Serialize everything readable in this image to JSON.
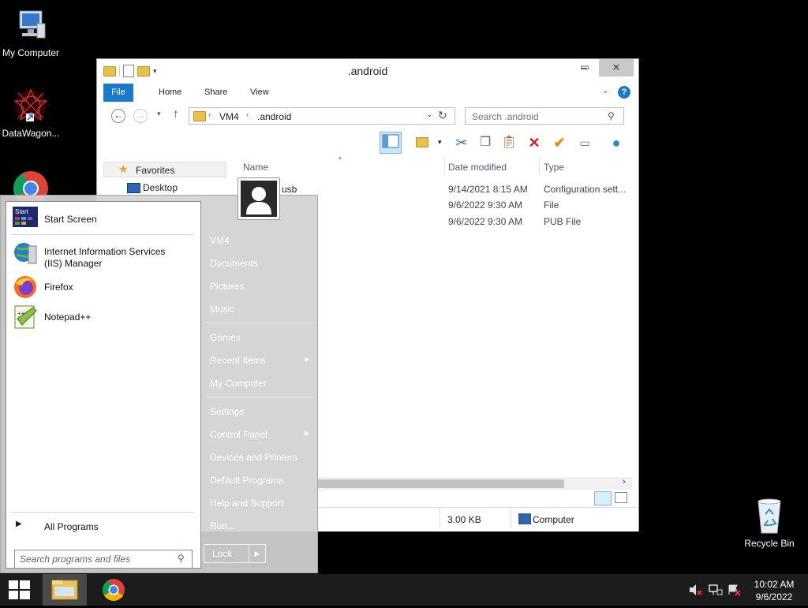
{
  "desktop": {
    "icons": [
      {
        "label": "My Computer"
      },
      {
        "label": "DataWagon..."
      },
      {
        "label": "Recycle Bin"
      }
    ]
  },
  "explorer": {
    "title": ".android",
    "window_buttons": {
      "minimize": "–",
      "maximize": "☐",
      "close": "✕"
    },
    "ribbon_tabs": [
      "File",
      "Home",
      "Share",
      "View"
    ],
    "breadcrumb": [
      "VM4",
      ".android"
    ],
    "search_placeholder": "Search .android",
    "columns": {
      "name": "Name",
      "date": "Date modified",
      "type": "Type"
    },
    "nav": {
      "favorites": "Favorites",
      "desktop": "Desktop"
    },
    "files": [
      {
        "name": "adb_usb",
        "visible_name": "usb",
        "date": "9/14/2021 8:15 AM",
        "type": "Configuration sett..."
      },
      {
        "name": "",
        "date": "9/6/2022 9:30 AM",
        "type": "File"
      },
      {
        "name": "",
        "date": "9/6/2022 9:30 AM",
        "type": "PUB File"
      }
    ],
    "status": {
      "size": "3.00 KB",
      "location": "Computer"
    }
  },
  "start_menu": {
    "programs": [
      {
        "label": "Start Screen",
        "icon": "start-screen-icon"
      },
      {
        "label": "Internet Information Services (IIS) Manager",
        "line1": "Internet Information Services",
        "line2": "(IIS) Manager",
        "icon": "iis-icon"
      },
      {
        "label": "Firefox",
        "icon": "firefox-icon"
      },
      {
        "label": "Notepad++",
        "icon": "notepadpp-icon"
      }
    ],
    "all_programs": "All Programs",
    "search_placeholder": "Search programs and files",
    "right_items": [
      "VM4",
      "Documents",
      "Pictures",
      "Music",
      "Games",
      "Recent Items",
      "My Computer",
      "Settings",
      "Control Panel",
      "Devices and Printers",
      "Default Programs",
      "Help and Support",
      "Run..."
    ],
    "lock_label": "Lock"
  },
  "taskbar": {
    "time": "10:02 AM",
    "date": "9/6/2022"
  }
}
